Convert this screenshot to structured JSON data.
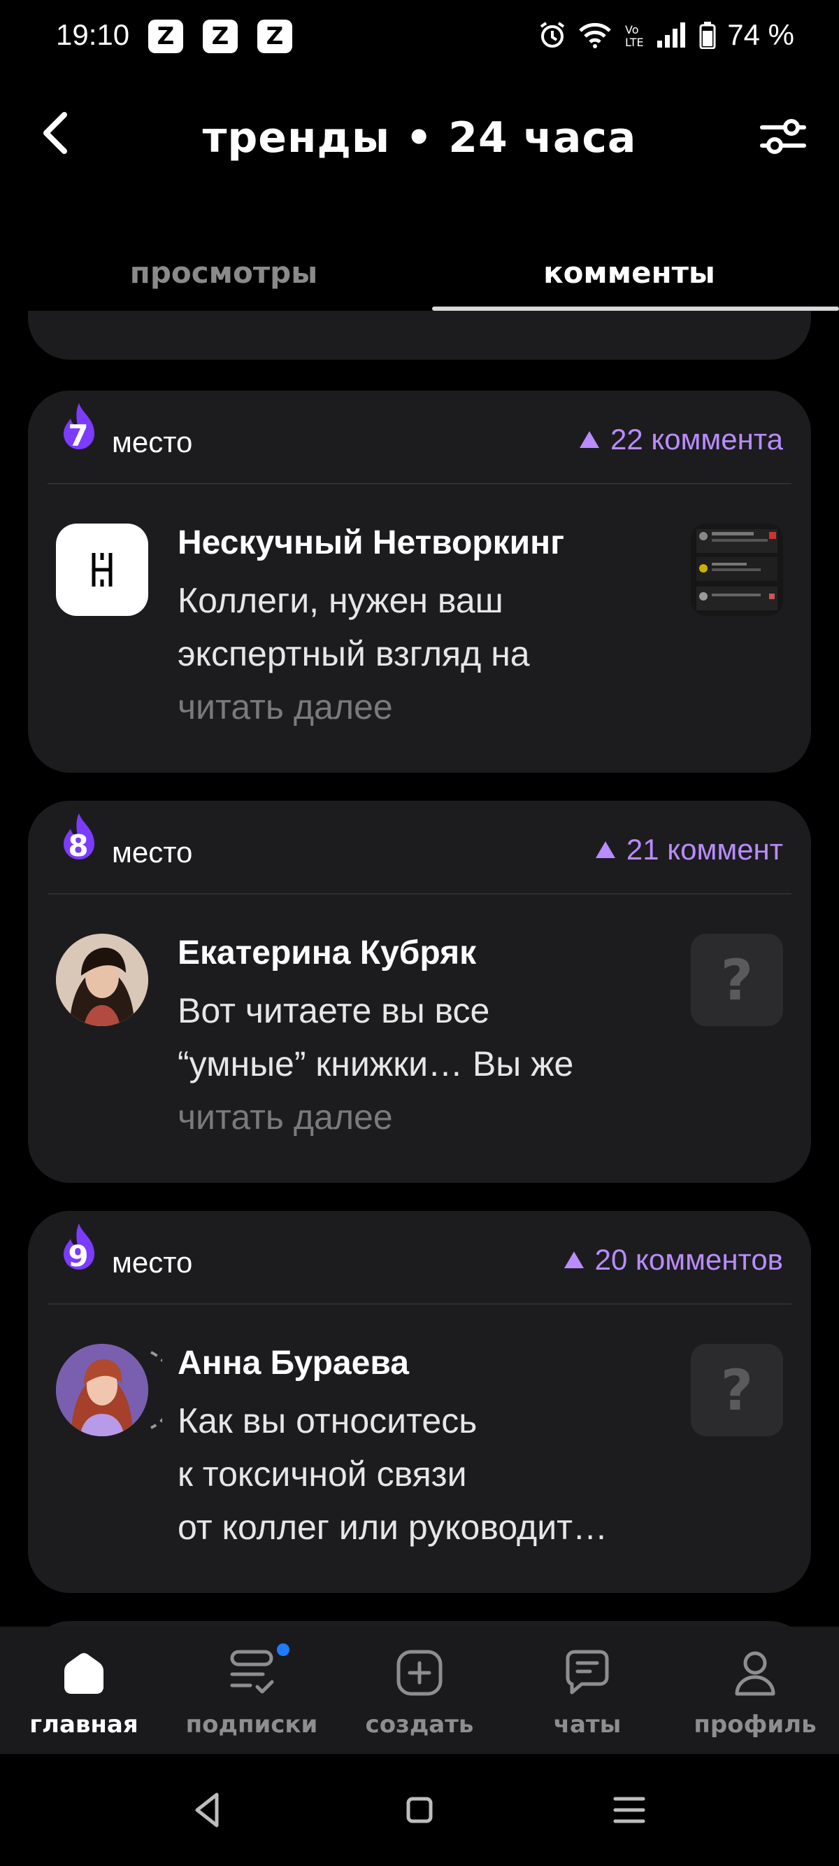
{
  "status_bar": {
    "time": "19:10",
    "notification_icons": [
      "app-z-icon",
      "app-z-icon",
      "app-z-icon"
    ],
    "battery": "74 %"
  },
  "header": {
    "title": "тренды • 24 часа"
  },
  "tabs": [
    {
      "label": "просмотры",
      "active": false
    },
    {
      "label": "комменты",
      "active": true
    }
  ],
  "feed": {
    "items": [
      {
        "rank": "7",
        "rank_label": "место",
        "comments": "22 коммента",
        "author": "Нескучный Нетворкинг",
        "excerpt_lines": [
          "Коллеги, нужен ваш",
          "экспертный взгляд на"
        ],
        "read_more": "читать далее",
        "avatar": "logo-nn",
        "thumb": "screenshot-thumbnail"
      },
      {
        "rank": "8",
        "rank_label": "место",
        "comments": "21 коммент",
        "author": "Екатерина Кубряк",
        "excerpt_lines": [
          "Вот читаете вы все",
          "“умные” книжки… Вы же"
        ],
        "read_more": "читать далее",
        "avatar": "photo",
        "thumb": "question-placeholder"
      },
      {
        "rank": "9",
        "rank_label": "место",
        "comments": "20 комментов",
        "author": "Анна Бураева",
        "excerpt_lines": [
          "Как вы относитесь",
          "к токсичной связи",
          "от коллег или руководит…"
        ],
        "read_more": "",
        "avatar": "photo",
        "thumb": "question-placeholder"
      }
    ]
  },
  "bottom_nav": [
    {
      "label": "главная",
      "icon": "home-icon",
      "active": true
    },
    {
      "label": "подписки",
      "icon": "subscriptions-icon",
      "active": false,
      "badge": true
    },
    {
      "label": "создать",
      "icon": "create-icon",
      "active": false
    },
    {
      "label": "чаты",
      "icon": "chat-icon",
      "active": false
    },
    {
      "label": "профиль",
      "icon": "profile-icon",
      "active": false
    }
  ],
  "colors": {
    "accent": "#b98cff",
    "flame": "#7b3cff",
    "card_bg": "#1c1c1e",
    "badge": "#1e7bff"
  }
}
